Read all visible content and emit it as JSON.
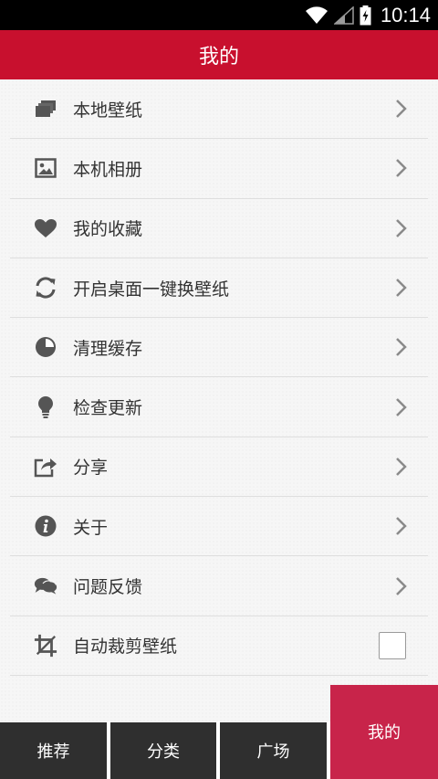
{
  "status_bar": {
    "time": "10:14"
  },
  "title_bar": {
    "title": "我的"
  },
  "menu": {
    "items": [
      {
        "label": "本地壁纸",
        "icon": "local-wallpaper-icon"
      },
      {
        "label": "本机相册",
        "icon": "image-icon"
      },
      {
        "label": "我的收藏",
        "icon": "heart-icon"
      },
      {
        "label": "开启桌面一键换壁纸",
        "icon": "refresh-icon"
      },
      {
        "label": "清理缓存",
        "icon": "pie-chart-icon"
      },
      {
        "label": "检查更新",
        "icon": "lightbulb-icon"
      },
      {
        "label": "分享",
        "icon": "share-icon"
      },
      {
        "label": "关于",
        "icon": "info-icon"
      },
      {
        "label": "问题反馈",
        "icon": "chat-bubbles-icon"
      }
    ],
    "auto_crop": {
      "label": "自动裁剪壁纸",
      "icon": "crop-icon",
      "checked": false
    }
  },
  "bottom_nav": {
    "tabs": [
      {
        "label": "推荐"
      },
      {
        "label": "分类"
      },
      {
        "label": "广场"
      },
      {
        "label": "我的",
        "active": true
      }
    ]
  },
  "colors": {
    "brand": "#c8102e",
    "active_tab": "#c8244a",
    "nav_bg": "#2f2f2f",
    "icon": "#555555"
  }
}
